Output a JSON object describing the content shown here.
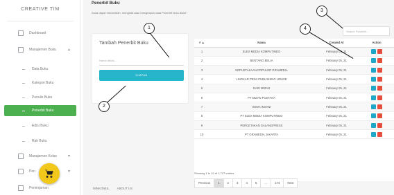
{
  "brand": "CREATIVE TIM",
  "sidebar": {
    "items": [
      {
        "label": "Dashboard"
      },
      {
        "label": "Manajemen Buku"
      },
      {
        "label": "Data Buku"
      },
      {
        "label": "Kategori Buku"
      },
      {
        "label": "Penulis Buku"
      },
      {
        "label": "Penerbit Buku"
      },
      {
        "label": "Edisi Buku"
      },
      {
        "label": "Rak Buku"
      },
      {
        "label": "Manajemen Kelas"
      },
      {
        "label": "Pen"
      },
      {
        "label": "Peminjaman"
      }
    ]
  },
  "header": {
    "title": "Penerbit Buku",
    "desc": "Anda dapat menambah, mengedit atau menghapus data Penerbit buku disini !"
  },
  "form": {
    "title": "Tambah Penerbit Buku",
    "placeholder": "Nama ditulis...",
    "submit": "SIMPAN"
  },
  "search": {
    "placeholder": "Search Penerbit..."
  },
  "table": {
    "columns": [
      "# ▲",
      "Nama",
      "Created At",
      "Action"
    ],
    "rows": [
      {
        "n": "1",
        "name": "ELEX MEDIA KOMPUTINDO",
        "date": "February 05, 21"
      },
      {
        "n": "2",
        "name": "BENTANG BELIA",
        "date": "February 05, 21"
      },
      {
        "n": "3",
        "name": "KEPUSTAKAAN POPULER GRAMEDIA",
        "date": "February 05, 21"
      },
      {
        "n": "4",
        "name": "LINGKAR PENA PUBLISHING HOUSE",
        "date": "February 05, 21"
      },
      {
        "n": "5",
        "name": "DAR! MIZAN",
        "date": "February 05, 21"
      },
      {
        "n": "6",
        "name": "PT MIZAN PUSTAKA",
        "date": "February 05, 21"
      },
      {
        "n": "7",
        "name": "GEMA INSANI",
        "date": "February 05, 21"
      },
      {
        "n": "8",
        "name": "PT ELEX MEDIA KOMPUTINDO",
        "date": "February 05, 21"
      },
      {
        "n": "9",
        "name": "PERCETAKAN GALANGPRESS",
        "date": "February 05, 21"
      },
      {
        "n": "10",
        "name": "PT GRAMEDIA JAKARTA",
        "date": "February 05, 21"
      }
    ],
    "showing": "Showing 1 to 10 of 1,727 entries"
  },
  "pager": [
    "Previous",
    "1",
    "2",
    "3",
    "4",
    "5",
    "...",
    "173",
    "Next"
  ],
  "footer": [
    "MINKOMUL",
    "ABOUT US"
  ],
  "markers": [
    "1",
    "2",
    "3",
    "4"
  ],
  "colors": {
    "active_nav": "#4caf50",
    "primary_button": "#26b5cb",
    "fab": "#f2c81a",
    "edit": "#20a7c9",
    "delete": "#e74c3c"
  },
  "icons": {
    "fab": "cart-icon"
  }
}
